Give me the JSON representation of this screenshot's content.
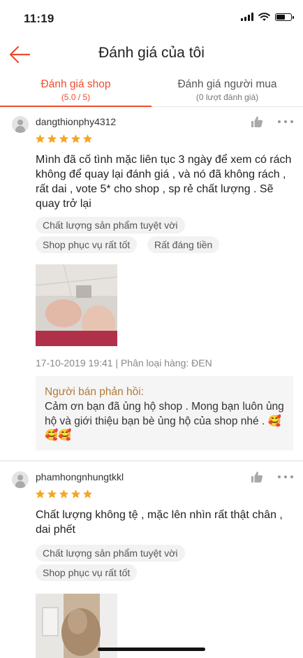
{
  "status": {
    "time": "11:19"
  },
  "header": {
    "title": "Đánh giá của tôi",
    "back_icon": "arrow-left-icon"
  },
  "tabs": [
    {
      "label": "Đánh giá shop",
      "sub": "(5.0 / 5)",
      "active": true
    },
    {
      "label": "Đánh giá người mua",
      "sub": "(0 lượt đánh giá)",
      "active": false
    }
  ],
  "reviews": [
    {
      "username": "dangthionphy4312",
      "rating": 5,
      "text": "Mình đã cố tình mặc liên tục 3 ngày để xem có rách không để quay lại đánh giá , và nó đã không rách , rất dai , vote 5* cho shop , sp rẻ chất lượng . Sẽ quay trở lại",
      "tags": [
        "Chất lượng sản phẩm tuyệt vời",
        "Shop phục vụ rất tốt",
        "Rất đáng tiền"
      ],
      "meta": "17-10-2019 19:41 | Phân loại hàng: ĐEN",
      "reply_label": "Người bán phản hồi:",
      "reply_text": "Cảm ơn bạn đã ủng hộ shop . Mong bạn luôn ủng hộ và giới thiệu bạn bè ủng hộ của shop nhé . 🥰🥰🥰"
    },
    {
      "username": "phamhongnhungtkkl",
      "rating": 5,
      "text": "Chất lượng không tệ , mặc lên nhìn rất thật chân , dai phết",
      "tags": [
        "Chất lượng sản phẩm tuyệt vời",
        "Shop phục vụ rất tốt"
      ]
    }
  ],
  "colors": {
    "accent": "#ee4d2d",
    "star": "#f5a623",
    "reply_label": "#b07a3c"
  }
}
